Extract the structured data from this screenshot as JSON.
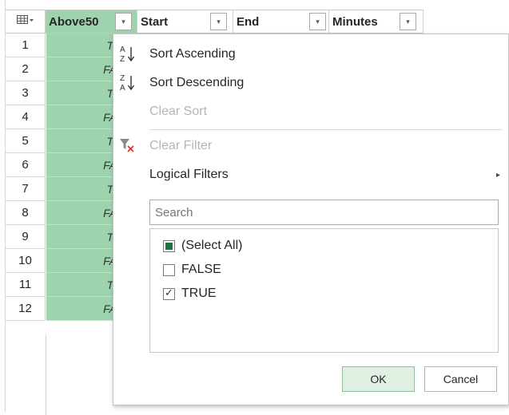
{
  "header": {
    "corner_icon": "table-icon",
    "columns": [
      {
        "label": "Above50",
        "selected": true
      },
      {
        "label": "Start",
        "selected": false
      },
      {
        "label": "End",
        "selected": false
      },
      {
        "label": "Minutes",
        "selected": false
      }
    ],
    "dropdown_glyph": "▾"
  },
  "rows": [
    {
      "num": "1",
      "value": "TI"
    },
    {
      "num": "2",
      "value": "FA"
    },
    {
      "num": "3",
      "value": "TI"
    },
    {
      "num": "4",
      "value": "FA"
    },
    {
      "num": "5",
      "value": "TI"
    },
    {
      "num": "6",
      "value": "FA"
    },
    {
      "num": "7",
      "value": "TI"
    },
    {
      "num": "8",
      "value": "FA"
    },
    {
      "num": "9",
      "value": "TI"
    },
    {
      "num": "10",
      "value": "FA"
    },
    {
      "num": "11",
      "value": "TI"
    },
    {
      "num": "12",
      "value": "FA"
    }
  ],
  "menu": {
    "sort_ascending": "Sort Ascending",
    "sort_descending": "Sort Descending",
    "clear_sort": "Clear Sort",
    "clear_filter": "Clear Filter",
    "logical_filters": "Logical Filters",
    "submenu_arrow": "▸",
    "search_placeholder": "Search",
    "items": [
      {
        "label": "(Select All)",
        "state": "partial"
      },
      {
        "label": "FALSE",
        "state": "unchecked"
      },
      {
        "label": "TRUE",
        "state": "checked"
      }
    ],
    "ok_label": "OK",
    "cancel_label": "Cancel"
  },
  "colors": {
    "selected_column": "#9fd3ae",
    "select_all_fill": "#1e7145",
    "ok_button_bg": "#dff0e3"
  }
}
